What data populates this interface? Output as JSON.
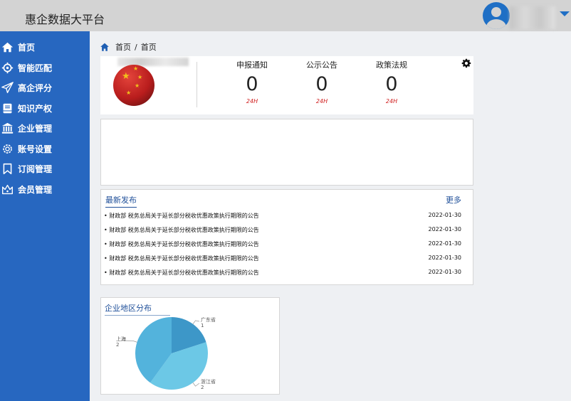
{
  "header": {
    "app_title": "惠企数据大平台"
  },
  "sidebar": {
    "items": [
      {
        "label": "首页",
        "icon": "home-icon"
      },
      {
        "label": "智能匹配",
        "icon": "target-icon"
      },
      {
        "label": "高企评分",
        "icon": "paper-plane-icon"
      },
      {
        "label": "知识产权",
        "icon": "book-icon"
      },
      {
        "label": "企业管理",
        "icon": "bank-icon"
      },
      {
        "label": "账号设置",
        "icon": "gear-icon"
      },
      {
        "label": "订阅管理",
        "icon": "bookmark-icon"
      },
      {
        "label": "会员管理",
        "icon": "crown-icon"
      }
    ]
  },
  "breadcrumb": {
    "home": "首页",
    "separator": "/",
    "current": "首页"
  },
  "stats": [
    {
      "label": "申报通知",
      "value": "0",
      "sub": "24H"
    },
    {
      "label": "公示公告",
      "value": "0",
      "sub": "24H"
    },
    {
      "label": "政策法规",
      "value": "0",
      "sub": "24H"
    }
  ],
  "news": {
    "title": "最新发布",
    "more": "更多",
    "items": [
      {
        "text": "财政部 税务总局关于延长部分税收优惠政策执行期限的公告",
        "date": "2022-01-30"
      },
      {
        "text": "财政部 税务总局关于延长部分税收优惠政策执行期限的公告",
        "date": "2022-01-30"
      },
      {
        "text": "财政部 税务总局关于延长部分税收优惠政策执行期限的公告",
        "date": "2022-01-30"
      },
      {
        "text": "财政部 税务总局关于延长部分税收优惠政策执行期限的公告",
        "date": "2022-01-30"
      },
      {
        "text": "财政部 税务总局关于延长部分税收优惠政策执行期限的公告",
        "date": "2022-01-30"
      }
    ]
  },
  "chart_data": {
    "type": "pie",
    "title": "企业地区分布",
    "slices": [
      {
        "label": "广东省",
        "value": 1,
        "color": "#3d97c8"
      },
      {
        "label": "浙江省",
        "value": 2,
        "color": "#6cc8e6"
      },
      {
        "label": "上海",
        "value": 2,
        "color": "#53b3dc"
      }
    ]
  },
  "colors": {
    "sidebar": "#2767c0",
    "accent": "#1f4f99",
    "highlight": "#d01b1b"
  }
}
